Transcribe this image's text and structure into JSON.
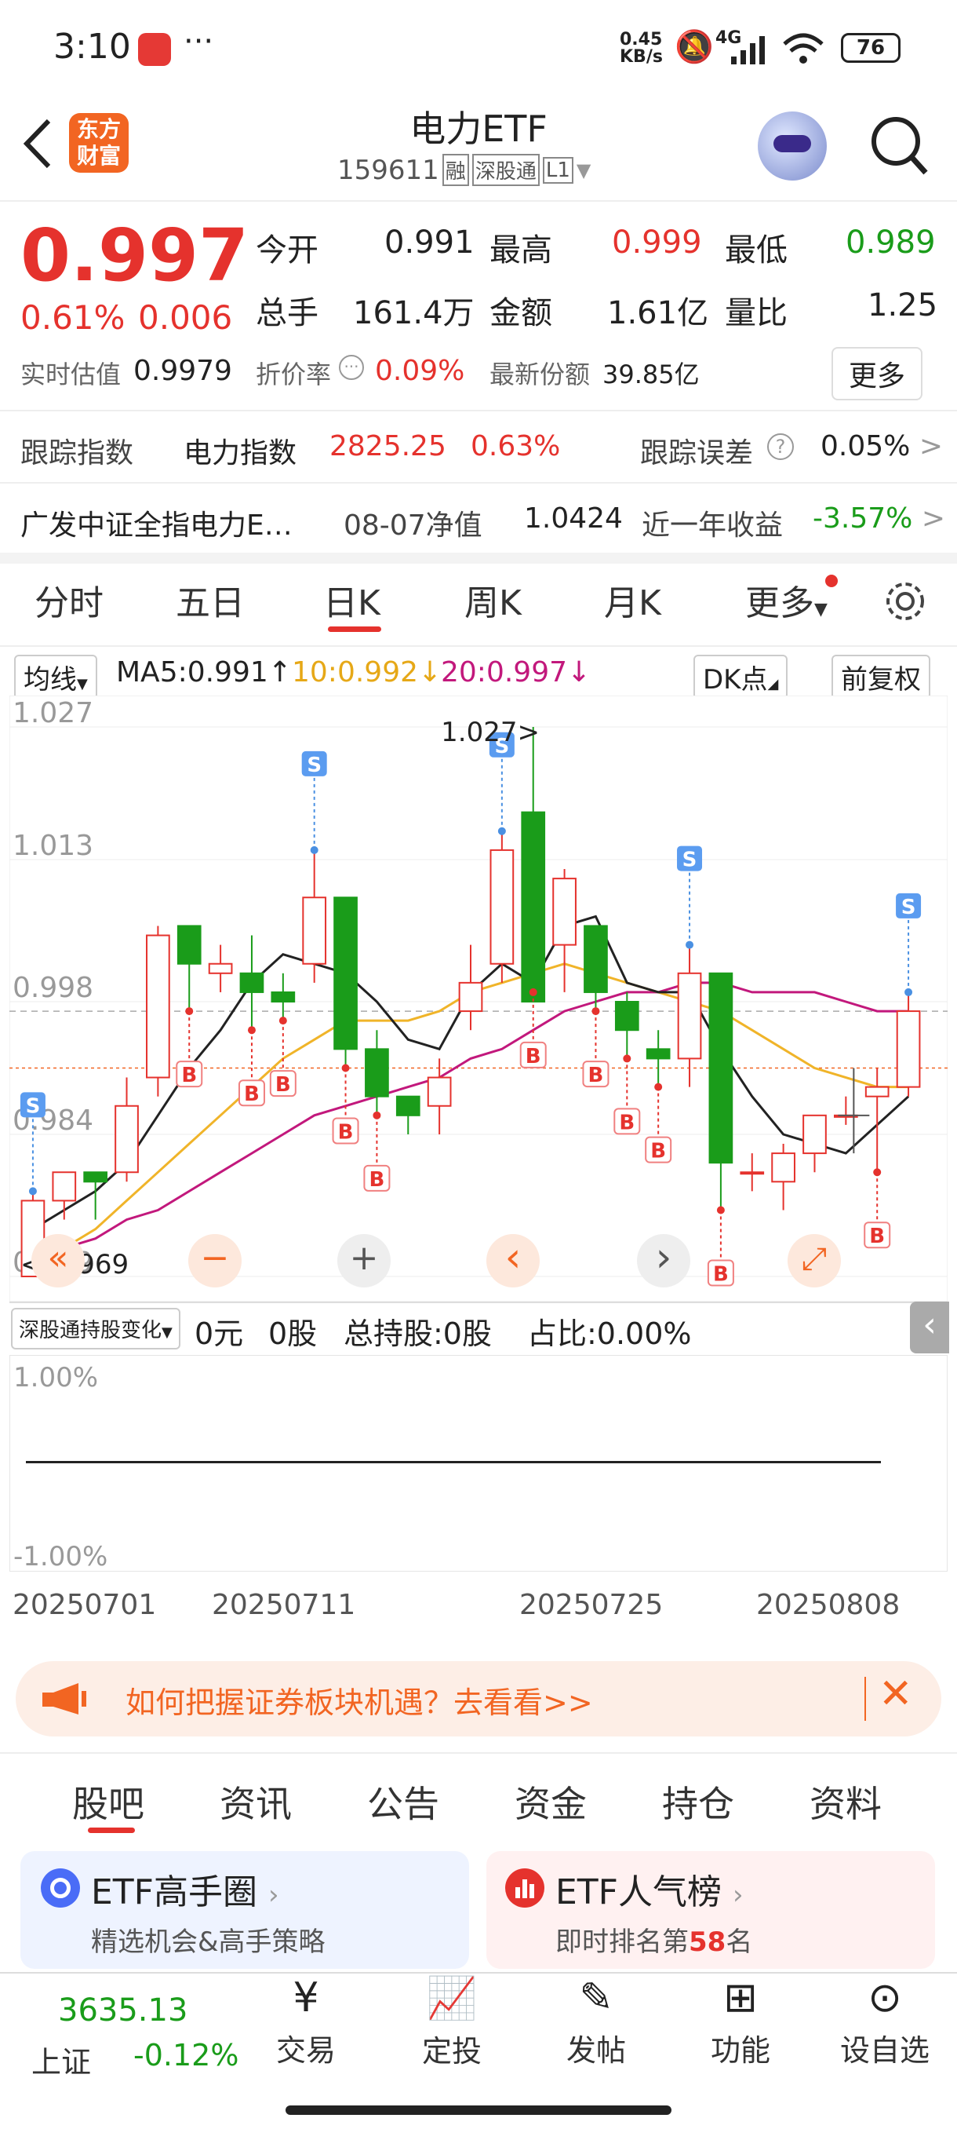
{
  "status": {
    "time": "3:10",
    "speed": "0.45\nKB/s",
    "speed_val": "0.45",
    "speed_unit": "KB/s",
    "network": "4G",
    "battery": "76"
  },
  "header": {
    "title": "电力ETF",
    "code": "159611",
    "badge1": "融",
    "badge2": "深股通",
    "badge3": "L1",
    "brand_line1": "东方",
    "brand_line2": "财富"
  },
  "quote": {
    "price": "0.997",
    "pct": "0.61%",
    "chg": "0.006",
    "open_label": "今开",
    "open": "0.991",
    "high_label": "最高",
    "high": "0.999",
    "low_label": "最低",
    "low": "0.989",
    "vol_label": "总手",
    "vol": "161.4万",
    "amt_label": "金额",
    "amt": "1.61亿",
    "ratio_label": "量比",
    "ratio": "1.25",
    "iopv_label": "实时估值",
    "iopv": "0.9979",
    "premium_label": "折价率",
    "premium": "0.09%",
    "shares_label": "最新份额",
    "shares": "39.85亿",
    "more": "更多"
  },
  "tracking": {
    "label": "跟踪指数",
    "index_name": "电力指数",
    "index_value": "2825.25",
    "index_pct": "0.63%",
    "err_label": "跟踪误差",
    "err": "0.05%"
  },
  "fund": {
    "name": "广发中证全指电力E…",
    "nav_label": "08-07净值",
    "nav": "1.0424",
    "ret_label": "近一年收益",
    "ret": "-3.57%"
  },
  "tabs": [
    "分时",
    "五日",
    "日K",
    "周K",
    "月K",
    "更多"
  ],
  "active_tab": "日K",
  "ma": {
    "type": "均线",
    "ma5": "MA5:0.991",
    "ma10": "10:0.992",
    "ma20": "20:0.997",
    "dk": "DK点",
    "adj": "前复权"
  },
  "chart_data": {
    "type": "candlestick",
    "y_ticks": [
      "1.027",
      "1.013",
      "0.998",
      "0.984",
      "0.969"
    ],
    "ylim": [
      0.969,
      1.027
    ],
    "x_labels": [
      "20250701",
      "20250711",
      "20250725",
      "20250808"
    ],
    "max_label": "1.027>",
    "min_label": "<-0.969",
    "candles": [
      {
        "o": 0.969,
        "h": 0.978,
        "l": 0.969,
        "c": 0.977
      },
      {
        "o": 0.977,
        "h": 0.98,
        "l": 0.975,
        "c": 0.98
      },
      {
        "o": 0.98,
        "h": 0.98,
        "l": 0.975,
        "c": 0.979
      },
      {
        "o": 0.98,
        "h": 0.99,
        "l": 0.979,
        "c": 0.987
      },
      {
        "o": 0.99,
        "h": 1.006,
        "l": 0.988,
        "c": 1.005
      },
      {
        "o": 1.006,
        "h": 1.006,
        "l": 0.997,
        "c": 1.002
      },
      {
        "o": 1.001,
        "h": 1.004,
        "l": 0.999,
        "c": 1.002
      },
      {
        "o": 1.001,
        "h": 1.005,
        "l": 0.995,
        "c": 0.999
      },
      {
        "o": 0.999,
        "h": 1.001,
        "l": 0.996,
        "c": 0.998
      },
      {
        "o": 1.002,
        "h": 1.014,
        "l": 1.0,
        "c": 1.009
      },
      {
        "o": 1.009,
        "h": 1.009,
        "l": 0.991,
        "c": 0.993
      },
      {
        "o": 0.993,
        "h": 0.995,
        "l": 0.986,
        "c": 0.988
      },
      {
        "o": 0.988,
        "h": 0.988,
        "l": 0.984,
        "c": 0.986
      },
      {
        "o": 0.987,
        "h": 0.992,
        "l": 0.984,
        "c": 0.99
      },
      {
        "o": 0.997,
        "h": 1.004,
        "l": 0.995,
        "c": 1.0
      },
      {
        "o": 1.002,
        "h": 1.016,
        "l": 1.0,
        "c": 1.014
      },
      {
        "o": 1.018,
        "h": 1.027,
        "l": 0.999,
        "c": 0.998
      },
      {
        "o": 1.004,
        "h": 1.012,
        "l": 0.999,
        "c": 1.011
      },
      {
        "o": 1.006,
        "h": 1.006,
        "l": 0.997,
        "c": 0.999
      },
      {
        "o": 0.998,
        "h": 0.999,
        "l": 0.992,
        "c": 0.995
      },
      {
        "o": 0.993,
        "h": 0.995,
        "l": 0.989,
        "c": 0.992
      },
      {
        "o": 0.992,
        "h": 1.004,
        "l": 0.989,
        "c": 1.001
      },
      {
        "o": 1.001,
        "h": 1.001,
        "l": 0.976,
        "c": 0.981
      },
      {
        "o": 0.98,
        "h": 0.982,
        "l": 0.978,
        "c": 0.98
      },
      {
        "o": 0.979,
        "h": 0.983,
        "l": 0.976,
        "c": 0.982
      },
      {
        "o": 0.982,
        "h": 0.986,
        "l": 0.98,
        "c": 0.986
      },
      {
        "o": 0.986,
        "h": 0.988,
        "l": 0.985,
        "c": 0.986
      },
      {
        "o": 0.988,
        "h": 0.991,
        "l": 0.98,
        "c": 0.989
      },
      {
        "o": 0.989,
        "h": 0.999,
        "l": 0.988,
        "c": 0.997
      }
    ],
    "ma5": [
      0.974,
      0.976,
      0.978,
      0.981,
      0.986,
      0.991,
      0.995,
      1.0,
      1.003,
      1.002,
      1.001,
      0.998,
      0.994,
      0.993,
      0.999,
      1.002,
      1.0,
      1.006,
      1.007,
      1.0,
      0.999,
      0.999,
      0.993,
      0.988,
      0.984,
      0.983,
      0.982,
      0.985,
      0.988
    ],
    "ma10": [
      0.971,
      0.972,
      0.974,
      0.977,
      0.98,
      0.983,
      0.986,
      0.989,
      0.992,
      0.994,
      0.996,
      0.996,
      0.996,
      0.997,
      0.999,
      1.0,
      1.001,
      1.002,
      1.001,
      1.0,
      0.999,
      0.998,
      0.997,
      0.995,
      0.993,
      0.991,
      0.99,
      0.989,
      0.989
    ],
    "ma20": [
      0.971,
      0.972,
      0.973,
      0.975,
      0.976,
      0.978,
      0.98,
      0.982,
      0.984,
      0.986,
      0.987,
      0.988,
      0.989,
      0.99,
      0.992,
      0.993,
      0.995,
      0.997,
      0.998,
      0.999,
      0.999,
      1.0,
      1.0,
      0.999,
      0.999,
      0.999,
      0.998,
      0.997,
      0.997
    ],
    "s_marks": [
      0,
      9,
      15,
      21,
      28
    ],
    "b_marks": [
      5,
      7,
      8,
      10,
      11,
      16,
      18,
      19,
      20,
      22,
      27
    ]
  },
  "controls": {
    "first": "«",
    "minus": "−",
    "plus": "+",
    "prev": "‹",
    "next": "›",
    "expand": "⤢"
  },
  "holding": {
    "select": "深股通持股变化",
    "value": "0元",
    "shares": "0股",
    "total": "总持股:0股",
    "ratio": "占比:0.00%",
    "top": "1.00%",
    "bottom": "-1.00%"
  },
  "banner": {
    "text": "如何把握证券板块机遇？去看看>>"
  },
  "bottom_tabs": [
    "股吧",
    "资讯",
    "公告",
    "资金",
    "持仓",
    "资料"
  ],
  "cards": [
    {
      "title": "ETF高手圈",
      "sub": "精选机会&高手策略"
    },
    {
      "title": "ETF人气榜",
      "sub_pre": "即时排名第",
      "rank": "58",
      "sub_post": "名"
    }
  ],
  "bottom_nav": {
    "index_value": "3635.13",
    "index_name": "上证",
    "index_pct": "-0.12%",
    "items": [
      "交易",
      "定投",
      "发帖",
      "功能",
      "设自选"
    ]
  }
}
